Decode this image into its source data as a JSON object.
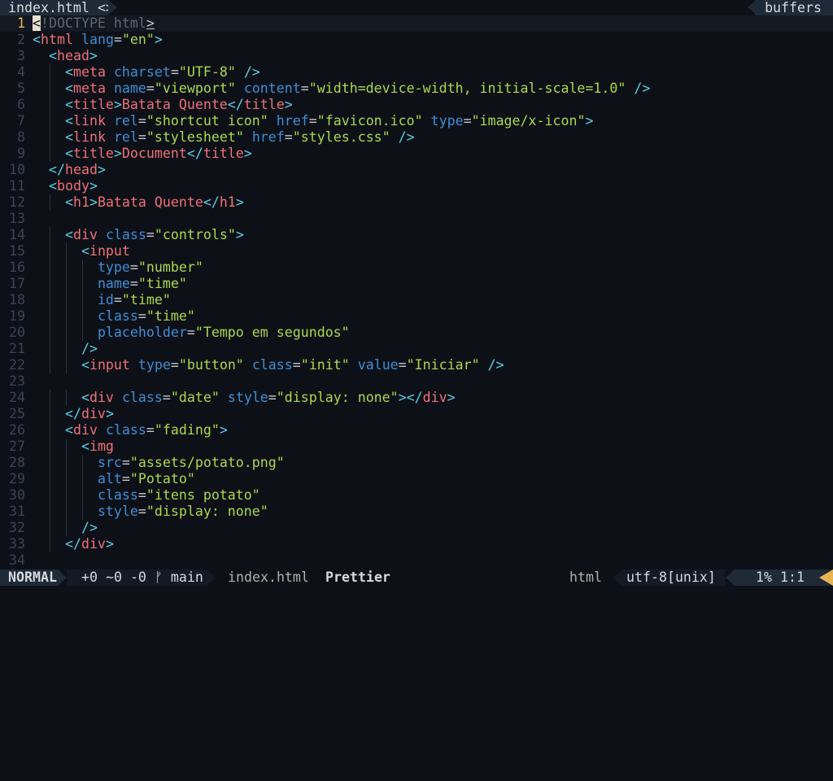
{
  "tabline": {
    "active_tab": "index.html <>",
    "buffers_label": "buffers"
  },
  "colors": {
    "background": "#0d1017",
    "tag": "#f07178",
    "attribute": "#3d8fd8",
    "string": "#aad94c",
    "punctuation": "#5ccfe6",
    "line_number": "#3b4455",
    "current_line_number": "#e6b450"
  },
  "editor": {
    "current_line": 1,
    "lines": [
      {
        "n": "1",
        "indent": 0,
        "tokens": [
          {
            "t": "cursor",
            "v": "<"
          },
          {
            "t": "doctype",
            "v": "!DOCTYPE html"
          },
          {
            "t": "brk_u",
            "v": ">"
          }
        ]
      },
      {
        "n": "2",
        "indent": 0,
        "tokens": [
          {
            "t": "punct",
            "v": "<"
          },
          {
            "t": "tag",
            "v": "html"
          },
          {
            "t": "sp",
            "v": " "
          },
          {
            "t": "attr",
            "v": "lang"
          },
          {
            "t": "eq",
            "v": "="
          },
          {
            "t": "str",
            "v": "\"en\""
          },
          {
            "t": "punct",
            "v": ">"
          }
        ]
      },
      {
        "n": "3",
        "indent": 1,
        "tokens": [
          {
            "t": "punct",
            "v": "<"
          },
          {
            "t": "tag",
            "v": "head"
          },
          {
            "t": "punct",
            "v": ">"
          }
        ]
      },
      {
        "n": "4",
        "indent": 2,
        "tokens": [
          {
            "t": "punct",
            "v": "<"
          },
          {
            "t": "tag",
            "v": "meta"
          },
          {
            "t": "sp",
            "v": " "
          },
          {
            "t": "attr",
            "v": "charset"
          },
          {
            "t": "eq",
            "v": "="
          },
          {
            "t": "str",
            "v": "\"UTF-8\""
          },
          {
            "t": "sp",
            "v": " "
          },
          {
            "t": "punct",
            "v": "/>"
          }
        ]
      },
      {
        "n": "5",
        "indent": 2,
        "tokens": [
          {
            "t": "punct",
            "v": "<"
          },
          {
            "t": "tag",
            "v": "meta"
          },
          {
            "t": "sp",
            "v": " "
          },
          {
            "t": "attr",
            "v": "name"
          },
          {
            "t": "eq",
            "v": "="
          },
          {
            "t": "str",
            "v": "\"viewport\""
          },
          {
            "t": "sp",
            "v": " "
          },
          {
            "t": "attr",
            "v": "content"
          },
          {
            "t": "eq",
            "v": "="
          },
          {
            "t": "str",
            "v": "\"width=device-width, initial-scale=1.0\""
          },
          {
            "t": "sp",
            "v": " "
          },
          {
            "t": "punct",
            "v": "/>"
          }
        ]
      },
      {
        "n": "6",
        "indent": 2,
        "tokens": [
          {
            "t": "punct",
            "v": "<"
          },
          {
            "t": "tag",
            "v": "title"
          },
          {
            "t": "punct",
            "v": ">"
          },
          {
            "t": "text",
            "v": "Batata Quente"
          },
          {
            "t": "punct",
            "v": "</"
          },
          {
            "t": "tag",
            "v": "title"
          },
          {
            "t": "punct",
            "v": ">"
          }
        ]
      },
      {
        "n": "7",
        "indent": 2,
        "tokens": [
          {
            "t": "punct",
            "v": "<"
          },
          {
            "t": "tag",
            "v": "link"
          },
          {
            "t": "sp",
            "v": " "
          },
          {
            "t": "attr",
            "v": "rel"
          },
          {
            "t": "eq",
            "v": "="
          },
          {
            "t": "str",
            "v": "\"shortcut icon\""
          },
          {
            "t": "sp",
            "v": " "
          },
          {
            "t": "attr",
            "v": "href"
          },
          {
            "t": "eq",
            "v": "="
          },
          {
            "t": "str",
            "v": "\"favicon.ico\""
          },
          {
            "t": "sp",
            "v": " "
          },
          {
            "t": "attr",
            "v": "type"
          },
          {
            "t": "eq",
            "v": "="
          },
          {
            "t": "str",
            "v": "\"image/x-icon\""
          },
          {
            "t": "punct",
            "v": ">"
          }
        ]
      },
      {
        "n": "8",
        "indent": 2,
        "tokens": [
          {
            "t": "punct",
            "v": "<"
          },
          {
            "t": "tag",
            "v": "link"
          },
          {
            "t": "sp",
            "v": " "
          },
          {
            "t": "attr",
            "v": "rel"
          },
          {
            "t": "eq",
            "v": "="
          },
          {
            "t": "str",
            "v": "\"stylesheet\""
          },
          {
            "t": "sp",
            "v": " "
          },
          {
            "t": "attr",
            "v": "href"
          },
          {
            "t": "eq",
            "v": "="
          },
          {
            "t": "str",
            "v": "\"styles.css\""
          },
          {
            "t": "sp",
            "v": " "
          },
          {
            "t": "punct",
            "v": "/>"
          }
        ]
      },
      {
        "n": "9",
        "indent": 2,
        "tokens": [
          {
            "t": "punct",
            "v": "<"
          },
          {
            "t": "tag",
            "v": "title"
          },
          {
            "t": "punct",
            "v": ">"
          },
          {
            "t": "text",
            "v": "Document"
          },
          {
            "t": "punct",
            "v": "</"
          },
          {
            "t": "tag",
            "v": "title"
          },
          {
            "t": "punct",
            "v": ">"
          }
        ]
      },
      {
        "n": "10",
        "indent": 1,
        "tokens": [
          {
            "t": "punct",
            "v": "</"
          },
          {
            "t": "tag",
            "v": "head"
          },
          {
            "t": "punct",
            "v": ">"
          }
        ]
      },
      {
        "n": "11",
        "indent": 1,
        "tokens": [
          {
            "t": "punct",
            "v": "<"
          },
          {
            "t": "tag",
            "v": "body"
          },
          {
            "t": "punct",
            "v": ">"
          }
        ]
      },
      {
        "n": "12",
        "indent": 2,
        "tokens": [
          {
            "t": "punct",
            "v": "<"
          },
          {
            "t": "tag",
            "v": "h1"
          },
          {
            "t": "punct",
            "v": ">"
          },
          {
            "t": "text",
            "v": "Batata Quente"
          },
          {
            "t": "punct",
            "v": "</"
          },
          {
            "t": "tag",
            "v": "h1"
          },
          {
            "t": "punct",
            "v": ">"
          }
        ]
      },
      {
        "n": "13",
        "indent": 0,
        "tokens": []
      },
      {
        "n": "14",
        "indent": 2,
        "tokens": [
          {
            "t": "punct",
            "v": "<"
          },
          {
            "t": "tag",
            "v": "div"
          },
          {
            "t": "sp",
            "v": " "
          },
          {
            "t": "attr",
            "v": "class"
          },
          {
            "t": "eq",
            "v": "="
          },
          {
            "t": "str",
            "v": "\"controls\""
          },
          {
            "t": "punct",
            "v": ">"
          }
        ]
      },
      {
        "n": "15",
        "indent": 3,
        "tokens": [
          {
            "t": "punct",
            "v": "<"
          },
          {
            "t": "tag",
            "v": "input"
          }
        ]
      },
      {
        "n": "16",
        "indent": 4,
        "tokens": [
          {
            "t": "attr",
            "v": "type"
          },
          {
            "t": "eq",
            "v": "="
          },
          {
            "t": "str",
            "v": "\"number\""
          }
        ]
      },
      {
        "n": "17",
        "indent": 4,
        "tokens": [
          {
            "t": "attr",
            "v": "name"
          },
          {
            "t": "eq",
            "v": "="
          },
          {
            "t": "str",
            "v": "\"time\""
          }
        ]
      },
      {
        "n": "18",
        "indent": 4,
        "tokens": [
          {
            "t": "attr",
            "v": "id"
          },
          {
            "t": "eq",
            "v": "="
          },
          {
            "t": "str",
            "v": "\"time\""
          }
        ]
      },
      {
        "n": "19",
        "indent": 4,
        "tokens": [
          {
            "t": "attr",
            "v": "class"
          },
          {
            "t": "eq",
            "v": "="
          },
          {
            "t": "str",
            "v": "\"time\""
          }
        ]
      },
      {
        "n": "20",
        "indent": 4,
        "tokens": [
          {
            "t": "attr",
            "v": "placeholder"
          },
          {
            "t": "eq",
            "v": "="
          },
          {
            "t": "str",
            "v": "\"Tempo em segundos\""
          }
        ]
      },
      {
        "n": "21",
        "indent": 3,
        "tokens": [
          {
            "t": "punct",
            "v": "/>"
          }
        ]
      },
      {
        "n": "22",
        "indent": 3,
        "tokens": [
          {
            "t": "punct",
            "v": "<"
          },
          {
            "t": "tag",
            "v": "input"
          },
          {
            "t": "sp",
            "v": " "
          },
          {
            "t": "attr",
            "v": "type"
          },
          {
            "t": "eq",
            "v": "="
          },
          {
            "t": "str",
            "v": "\"button\""
          },
          {
            "t": "sp",
            "v": " "
          },
          {
            "t": "attr",
            "v": "class"
          },
          {
            "t": "eq",
            "v": "="
          },
          {
            "t": "str",
            "v": "\"init\""
          },
          {
            "t": "sp",
            "v": " "
          },
          {
            "t": "attr",
            "v": "value"
          },
          {
            "t": "eq",
            "v": "="
          },
          {
            "t": "str",
            "v": "\"Iniciar\""
          },
          {
            "t": "sp",
            "v": " "
          },
          {
            "t": "punct",
            "v": "/>"
          }
        ]
      },
      {
        "n": "23",
        "indent": 0,
        "tokens": []
      },
      {
        "n": "24",
        "indent": 3,
        "tokens": [
          {
            "t": "punct",
            "v": "<"
          },
          {
            "t": "tag",
            "v": "div"
          },
          {
            "t": "sp",
            "v": " "
          },
          {
            "t": "attr",
            "v": "class"
          },
          {
            "t": "eq",
            "v": "="
          },
          {
            "t": "str",
            "v": "\"date\""
          },
          {
            "t": "sp",
            "v": " "
          },
          {
            "t": "attr",
            "v": "style"
          },
          {
            "t": "eq",
            "v": "="
          },
          {
            "t": "str",
            "v": "\"display: none\""
          },
          {
            "t": "punct",
            "v": "></"
          },
          {
            "t": "tag",
            "v": "div"
          },
          {
            "t": "punct",
            "v": ">"
          }
        ]
      },
      {
        "n": "25",
        "indent": 2,
        "tokens": [
          {
            "t": "punct",
            "v": "</"
          },
          {
            "t": "tag",
            "v": "div"
          },
          {
            "t": "punct",
            "v": ">"
          }
        ]
      },
      {
        "n": "26",
        "indent": 2,
        "tokens": [
          {
            "t": "punct",
            "v": "<"
          },
          {
            "t": "tag",
            "v": "div"
          },
          {
            "t": "sp",
            "v": " "
          },
          {
            "t": "attr",
            "v": "class"
          },
          {
            "t": "eq",
            "v": "="
          },
          {
            "t": "str",
            "v": "\"fading\""
          },
          {
            "t": "punct",
            "v": ">"
          }
        ]
      },
      {
        "n": "27",
        "indent": 3,
        "tokens": [
          {
            "t": "punct",
            "v": "<"
          },
          {
            "t": "tag",
            "v": "img"
          }
        ]
      },
      {
        "n": "28",
        "indent": 4,
        "tokens": [
          {
            "t": "attr",
            "v": "src"
          },
          {
            "t": "eq",
            "v": "="
          },
          {
            "t": "str",
            "v": "\"assets/potato.png\""
          }
        ]
      },
      {
        "n": "29",
        "indent": 4,
        "tokens": [
          {
            "t": "attr",
            "v": "alt"
          },
          {
            "t": "eq",
            "v": "="
          },
          {
            "t": "str",
            "v": "\"Potato\""
          }
        ]
      },
      {
        "n": "30",
        "indent": 4,
        "tokens": [
          {
            "t": "attr",
            "v": "class"
          },
          {
            "t": "eq",
            "v": "="
          },
          {
            "t": "str",
            "v": "\"itens potato\""
          }
        ]
      },
      {
        "n": "31",
        "indent": 4,
        "tokens": [
          {
            "t": "attr",
            "v": "style"
          },
          {
            "t": "eq",
            "v": "="
          },
          {
            "t": "str",
            "v": "\"display: none\""
          }
        ]
      },
      {
        "n": "32",
        "indent": 3,
        "tokens": [
          {
            "t": "punct",
            "v": "/>"
          }
        ]
      },
      {
        "n": "33",
        "indent": 2,
        "tokens": [
          {
            "t": "punct",
            "v": "</"
          },
          {
            "t": "tag",
            "v": "div"
          },
          {
            "t": "punct",
            "v": ">"
          }
        ]
      },
      {
        "n": "34",
        "indent": 0,
        "tokens": []
      }
    ]
  },
  "statusline": {
    "mode": "NORMAL",
    "git_diff": "+0 ~0 -0",
    "branch_icon": "git-branch-icon",
    "branch": "main",
    "filename": "index.html",
    "formatter": "Prettier",
    "filetype": "html",
    "encoding": "utf-8[unix]",
    "position": "1% 1:1"
  }
}
